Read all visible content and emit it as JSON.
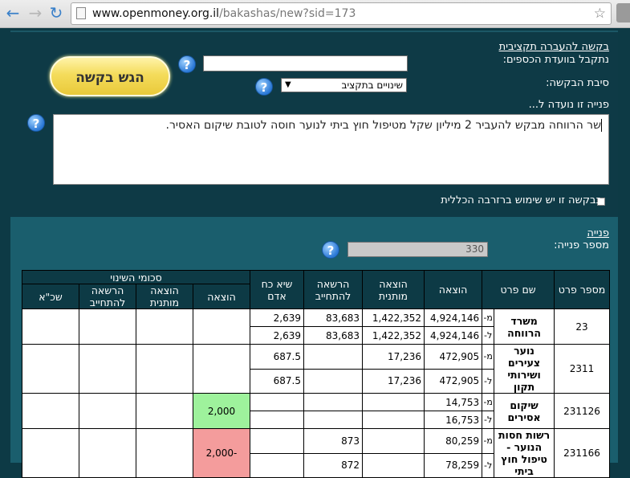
{
  "browser": {
    "url_host": "www.openmoney.org.il",
    "url_path": "/bakashas/new?sid=173"
  },
  "form": {
    "title_link": "בקשה להעברה תקציבית",
    "received_label": "נתקבל בוועדת הכספים:",
    "reason_label": "סיבת הבקשה:",
    "reason_value": "שינויים בתקציב",
    "addressed_label": "פנייה זו נועדה ל...",
    "description": "שר הרווחה מבקש להעביר 2 מיליון שקל  מטיפול חוץ ביתי לנוער חוסה לטובת שיקום האסיר.",
    "reserve_label": "בבקשה זו יש שימוש ברזרבה הכללית",
    "submit_label": "הגש בקשה",
    "help_glyph": "?"
  },
  "section2": {
    "link": "פנייה",
    "number_label": "מספר פנייה:",
    "number_value": "330"
  },
  "table": {
    "headers": {
      "code": "מספר פרט",
      "name": "שם פרט",
      "expense": "הוצאה",
      "cond_expense": "הוצאה מותנית",
      "commit": "הרשאה להתחייב",
      "peak": "שיא כח אדם",
      "change_group": "סכומי השינוי",
      "ch_expense": "הוצאה",
      "ch_cond": "הוצאה מותנית",
      "ch_commit": "הרשאה להתחייב",
      "ch_salary": "שכ\"א"
    },
    "from_mark": "מ-",
    "to_mark": "ל-",
    "rows": [
      {
        "code": "23",
        "name": "משרד הרווחה",
        "from": {
          "expense": "4,924,146",
          "cond": "1,422,352",
          "commit": "83,683",
          "peak": "2,639"
        },
        "to": {
          "expense": "4,924,146",
          "cond": "1,422,352",
          "commit": "83,683",
          "peak": "2,639"
        },
        "change": ""
      },
      {
        "code": "2311",
        "name": "נוער צעירים ושירותי תקון",
        "from": {
          "expense": "472,905",
          "cond": "17,236",
          "commit": "",
          "peak": "687.5"
        },
        "to": {
          "expense": "472,905",
          "cond": "17,236",
          "commit": "",
          "peak": "687.5"
        },
        "change": ""
      },
      {
        "code": "231126",
        "name": "שיקום אסירים",
        "from": {
          "expense": "14,753",
          "cond": "",
          "commit": "",
          "peak": ""
        },
        "to": {
          "expense": "16,753",
          "cond": "",
          "commit": "",
          "peak": ""
        },
        "change": "2,000"
      },
      {
        "code": "231166",
        "name": "רשות חסות הנוער - טיפול חוץ ביתי",
        "from": {
          "expense": "80,259",
          "cond": "",
          "commit": "873",
          "peak": ""
        },
        "to": {
          "expense": "78,259",
          "cond": "",
          "commit": "872",
          "peak": ""
        },
        "change": "-2,000"
      }
    ]
  },
  "colors": {
    "page_bg": "#0d3a45",
    "submit_yellow": "#f4dc5b",
    "increase_green": "#9ef29c",
    "decrease_red": "#f49c9c"
  }
}
